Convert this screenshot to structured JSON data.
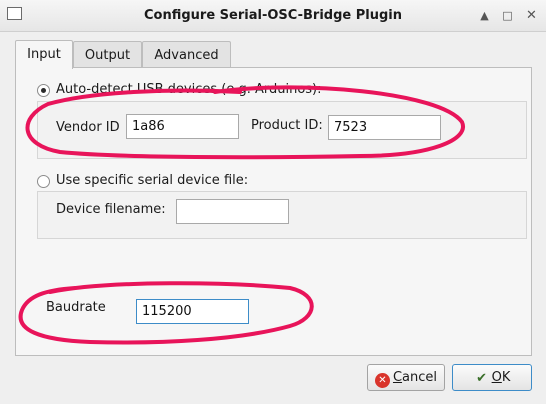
{
  "window": {
    "title": "Configure Serial-OSC-Bridge Plugin"
  },
  "tabs": [
    {
      "label": "Input",
      "active": true
    },
    {
      "label": "Output",
      "active": false
    },
    {
      "label": "Advanced",
      "active": false
    }
  ],
  "input": {
    "auto_detect_label": "Auto-detect USB devices (e.g. Arduinos):",
    "vendor_id_label": "Vendor ID",
    "vendor_id_value": "1a86",
    "product_id_label": "Product ID:",
    "product_id_value": "7523",
    "specific_file_label": "Use specific serial device file:",
    "device_filename_label": "Device filename:",
    "device_filename_value": "",
    "baudrate_label": "Baudrate",
    "baudrate_value": "115200"
  },
  "buttons": {
    "cancel_mnemonic": "C",
    "cancel_rest": "ancel",
    "ok_mnemonic": "O",
    "ok_rest": "K"
  },
  "colors": {
    "annotation": "#e8145a",
    "focus": "#3d8cc8",
    "cancel_icon": "#d9342b"
  }
}
